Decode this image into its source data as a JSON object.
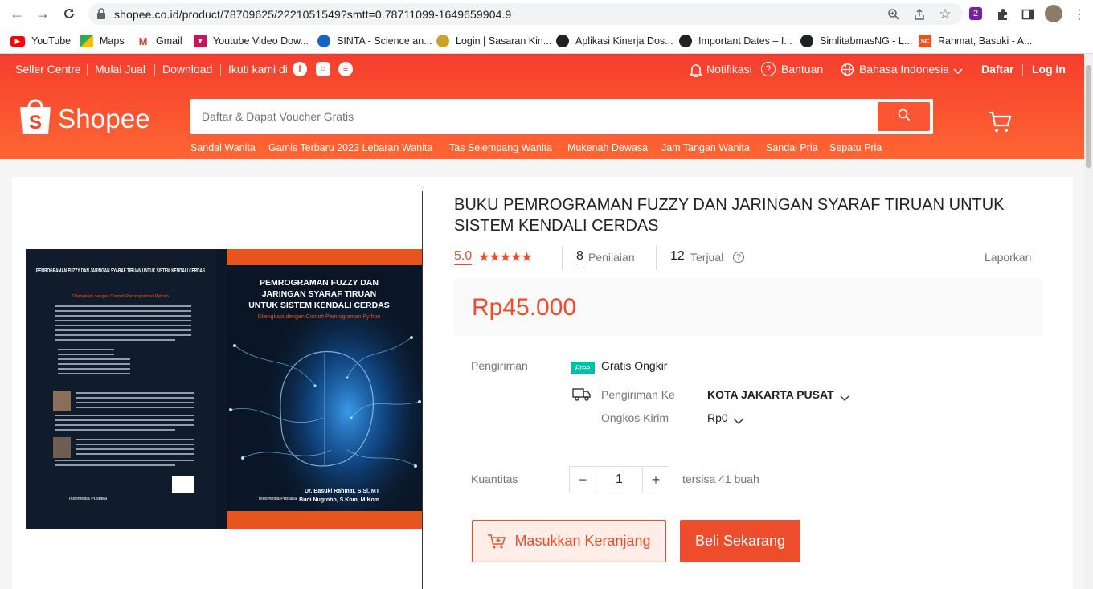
{
  "browser": {
    "url": "shopee.co.id/product/78709625/2221051549?smtt=0.78711099-1649659904.9",
    "bookmarks": [
      {
        "label": "YouTube",
        "icon": "youtube-icon",
        "color": "#ff0000"
      },
      {
        "label": "Maps",
        "icon": "maps-icon",
        "color": "#34a853"
      },
      {
        "label": "Gmail",
        "icon": "gmail-icon",
        "color": "#ea4335"
      },
      {
        "label": "Youtube Video Dow...",
        "icon": "video-download-icon",
        "color": "#c2185b"
      },
      {
        "label": "SINTA - Science an...",
        "icon": "sinta-icon",
        "color": "#1565c0"
      },
      {
        "label": "Login | Sasaran Kin...",
        "icon": "sasaran-icon",
        "color": "#c9a227"
      },
      {
        "label": "Aplikasi Kinerja Dos...",
        "icon": "globe-icon",
        "color": "#202124"
      },
      {
        "label": "Important Dates – I...",
        "icon": "globe-icon",
        "color": "#202124"
      },
      {
        "label": "SimlitabmasNG - L...",
        "icon": "globe-icon",
        "color": "#202124"
      },
      {
        "label": "Rahmat, Basuki - A...",
        "icon": "sc-icon",
        "color": "#e8541e",
        "badge": "SC"
      }
    ]
  },
  "topbar": {
    "seller_centre": "Seller Centre",
    "mulai_jual": "Mulai Jual",
    "download": "Download",
    "follow": "Ikuti kami di",
    "notifications": "Notifikasi",
    "help": "Bantuan",
    "language": "Bahasa Indonesia",
    "register": "Daftar",
    "login": "Log In"
  },
  "header": {
    "logo": "Shopee",
    "search_placeholder": "Daftar & Dapat Voucher Gratis",
    "categories": [
      "Sandal Wanita",
      "Gamis Terbaru 2023 Lebaran Wanita",
      "Tas Selempang Wanita",
      "Mukenah Dewasa",
      "Jam Tangan Wanita",
      "Sandal Pria",
      "Sepatu Pria"
    ]
  },
  "product": {
    "title": "BUKU PEMROGRAMAN FUZZY DAN JARINGAN SYARAF TIRUAN UNTUK SISTEM KENDALI CERDAS",
    "rating": "5.0",
    "stars": "★★★★★",
    "review_count": "8",
    "review_label": "Penilaian",
    "sold_count": "12",
    "sold_label": "Terjual",
    "report": "Laporkan",
    "price": "Rp45.000",
    "shipping_label": "Pengiriman",
    "free_badge": "Free",
    "free_shipping": "Gratis Ongkir",
    "ship_to_label": "Pengiriman Ke",
    "ship_to_value": "KOTA JAKARTA PUSAT",
    "ship_cost_label": "Ongkos Kirim",
    "ship_cost_value": "Rp0",
    "qty_label": "Kuantitas",
    "qty_value": "1",
    "stock": "tersisa 41 buah",
    "add_to_cart": "Masukkan Keranjang",
    "buy_now": "Beli Sekarang"
  },
  "cover": {
    "back_title": "PEMROGRAMAN FUZZY DAN JARINGAN SYARAF TIRUAN UNTUK SISTEM KENDALI CERDAS",
    "back_subtitle": "Dilengkapi dengan Contoh Pemrograman Python",
    "front_title_1": "PEMROGRAMAN FUZZY DAN",
    "front_title_2": "JARINGAN SYARAF TIRUAN",
    "front_title_3": "UNTUK SISTEM KENDALI CERDAS",
    "front_subtitle": "Dilengkapi dengan Contoh Pemrograman Python",
    "author_1": "Dr. Basuki Rahmat, S.Si, MT",
    "author_2": "Budi Nugroho, S.Kom, M.Kom",
    "publisher": "Indomedia Pustaka",
    "accent_color": "#e8541e"
  }
}
